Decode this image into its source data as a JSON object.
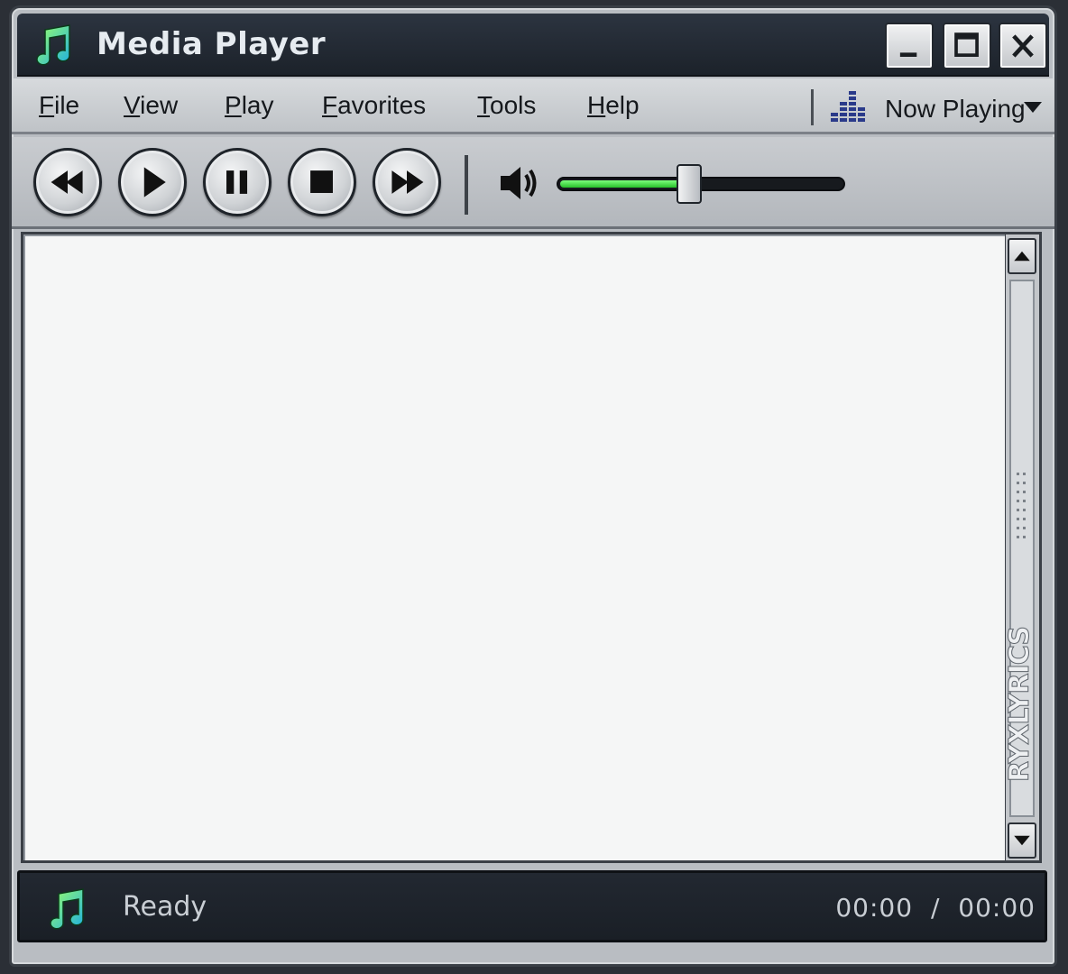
{
  "window": {
    "title": "Media Player"
  },
  "menu": {
    "items": [
      {
        "label": "File"
      },
      {
        "label": "View"
      },
      {
        "label": "Play"
      },
      {
        "label": "Favorites"
      },
      {
        "label": "Tools"
      },
      {
        "label": "Help"
      }
    ],
    "now_playing": "Now Playing"
  },
  "transport": {
    "buttons": [
      "rewind-icon",
      "play-icon",
      "pause-icon",
      "stop-icon",
      "fast-forward-icon"
    ],
    "volume_level": 0.46
  },
  "watermark": "RYXLYRICS",
  "status": {
    "text": "Ready",
    "elapsed": "00:00",
    "separator": "/",
    "total": "00:00"
  },
  "colors": {
    "accent_green": "#3ddc3d",
    "titlebar": "#232a33",
    "status_bg": "#1f252d"
  }
}
